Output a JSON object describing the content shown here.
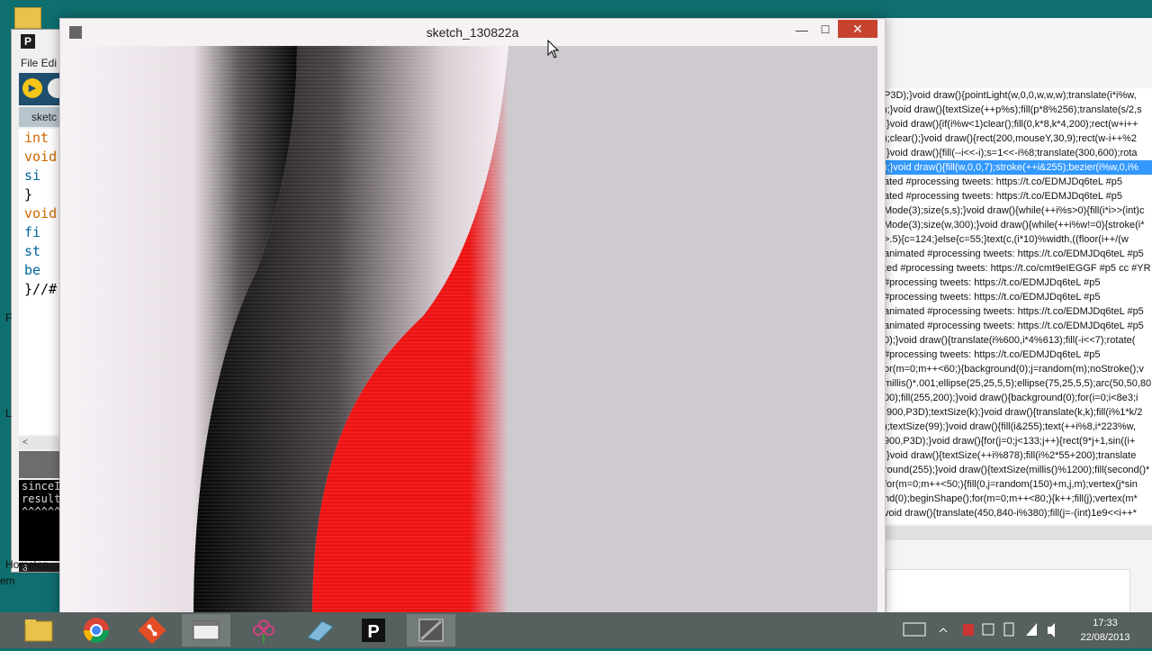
{
  "ide": {
    "menu": "File  Edi",
    "tab": "sketc",
    "code_lines": [
      "int",
      "void",
      "  si",
      "}",
      "void",
      "  fi",
      "  st",
      "  be",
      "}//#"
    ],
    "scroll_glyph": "<",
    "console_lines": [
      "",
      "sinceI",
      "result",
      "^^^^^^"
    ],
    "line_number": "8"
  },
  "left_edge_text": {
    "f": "F",
    "l": "L",
    "homeq": "Home\\cp...",
    "em": "em"
  },
  "sketch_window": {
    "title": "sketch_130822a",
    "minimize": "—",
    "maximize": "☐",
    "close": "✕"
  },
  "tweets": [
    "P3D);}void draw(){pointLight(w,0,0,w,w,w);translate(i*i%w,",
    ");}void draw(){textSize(++p%s);fill(p*8%256);translate(s/2,s",
    ";}void draw(){if(i%w<1)clear();fill(0,k*8,k*4,200);rect(w+i++",
    ");clear();}void draw(){rect(200,mouseY,30,9);rect(w-i++%2",
    ";}void draw(){fill(--i<<-i);s=1<<-i%8;translate(300,600);rota",
    ");}void draw(){fill(w,0,0,7);stroke(++i&255);bezier(i%w,0,i%",
    "ated #processing tweets: https://t.co/EDMJDq6teL #p5",
    "ated #processing tweets: https://t.co/EDMJDq6teL #p5",
    "Mode(3);size(s,s);}void draw(){while(++i%s>0){fill(i*i>>(int)c",
    "Mode(3);size(w,300);}void draw(){while(++i%w!=0){stroke(i*",
    ">.5){c=124;}else{c=55;}text(c,(i*10)%width,((floor(i++/(w",
    " animated #processing tweets: https://t.co/EDMJDq6teL #p5",
    "ted #processing tweets: https://t.co/cmt9eIEGGF #p5 cc #YR",
    " #processing tweets: https://t.co/EDMJDq6teL #p5",
    " #processing tweets: https://t.co/EDMJDq6teL #p5",
    " animated #processing tweets: https://t.co/EDMJDq6teL #p5",
    "animated #processing tweets: https://t.co/EDMJDq6teL #p5",
    "0);}void draw(){translate(i%600,i*4%613);fill(-i<<7);rotate(",
    " #processing tweets: https://t.co/EDMJDq6teL #p5",
    "or(m=0;m++<60;){background(0);j=random(m);noStroke();v",
    "millis()*.001;ellipse(25,25,5,5);ellipse(75,25,5,5);arc(50,50,80",
    "00);fill(255,200);}void draw(){background(0);for(i=0;i<8e3;i",
    ",900,P3D);textSize(k);}void draw(){translate(k,k);fill(i%1*k/2",
    ");textSize(99);}void draw(){fill(i&255);text(++i%8,i*223%w,",
    "900,P3D);}void draw(){for(j=0;j<133;j++){rect(9*j+1,sin((i+",
    ";}void draw(){textSize(++i%878);fill(i%2*55+200);translate",
    "round(255);}void draw(){textSize(millis()%1200);fill(second()*",
    "for(m=0;m++<50;){fill(0,j=random(150)+m,j,m);vertex(j*sin",
    "nd(0);beginShape();for(m=0;m++<80;){k++;fill(j);vertex(m*",
    "void draw(){translate(450,840-i%380);fill(j=-(int)1e9<<i++*"
  ],
  "selected_tweet_index": 5,
  "clock": {
    "time": "17:33",
    "date": "22/08/2013"
  },
  "taskbar": {
    "items": [
      "file-explorer-icon",
      "chrome-icon",
      "git-icon",
      "folder-window-icon",
      "flower-app-icon",
      "eraser-app-icon",
      "processing-icon",
      "sketch-window-icon"
    ]
  },
  "colors": {
    "desktop": "#0f6e6e",
    "red_shape": "#ee1111",
    "close_button": "#c7432f",
    "selection": "#3399ff"
  }
}
